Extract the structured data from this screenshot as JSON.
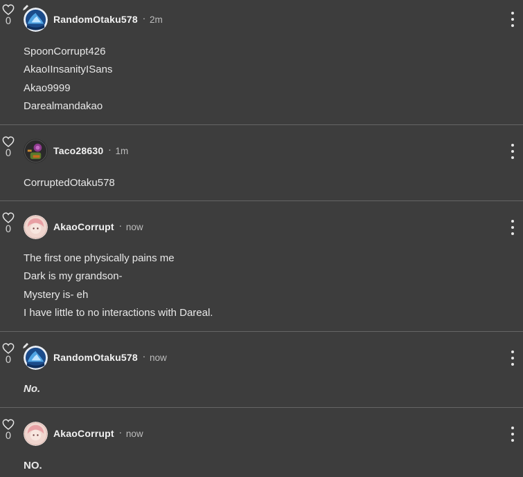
{
  "comments": [
    {
      "likes": "0",
      "username": "RandomOtaku578",
      "separator": "·",
      "time": "2m",
      "lines": [
        "SpoonCorrupt426",
        "AkaoIInsanityISans",
        "Akao9999",
        "Darealmandakao"
      ]
    },
    {
      "likes": "0",
      "username": "Taco28630",
      "separator": "·",
      "time": "1m",
      "lines": [
        "CorruptedOtaku578"
      ]
    },
    {
      "likes": "0",
      "username": "AkaoCorrupt",
      "separator": "·",
      "time": "now",
      "lines": [
        "The first one physically pains me",
        "Dark is my grandson-",
        "Mystery is- eh",
        "I have little to no interactions with Dareal."
      ]
    },
    {
      "likes": "0",
      "username": "RandomOtaku578",
      "separator": "·",
      "time": "now",
      "lines": [
        "No."
      ]
    },
    {
      "likes": "0",
      "username": "AkaoCorrupt",
      "separator": "·",
      "time": "now",
      "lines": [
        "NO."
      ]
    }
  ],
  "icons": {
    "like": "heart-outline-icon",
    "menu": "kebab-menu-icon",
    "edit": "pencil-icon"
  },
  "colors": {
    "background": "#3d3d3d",
    "divider": "#666666",
    "text": "#e8e8e8",
    "muted": "#bdbdbd"
  }
}
